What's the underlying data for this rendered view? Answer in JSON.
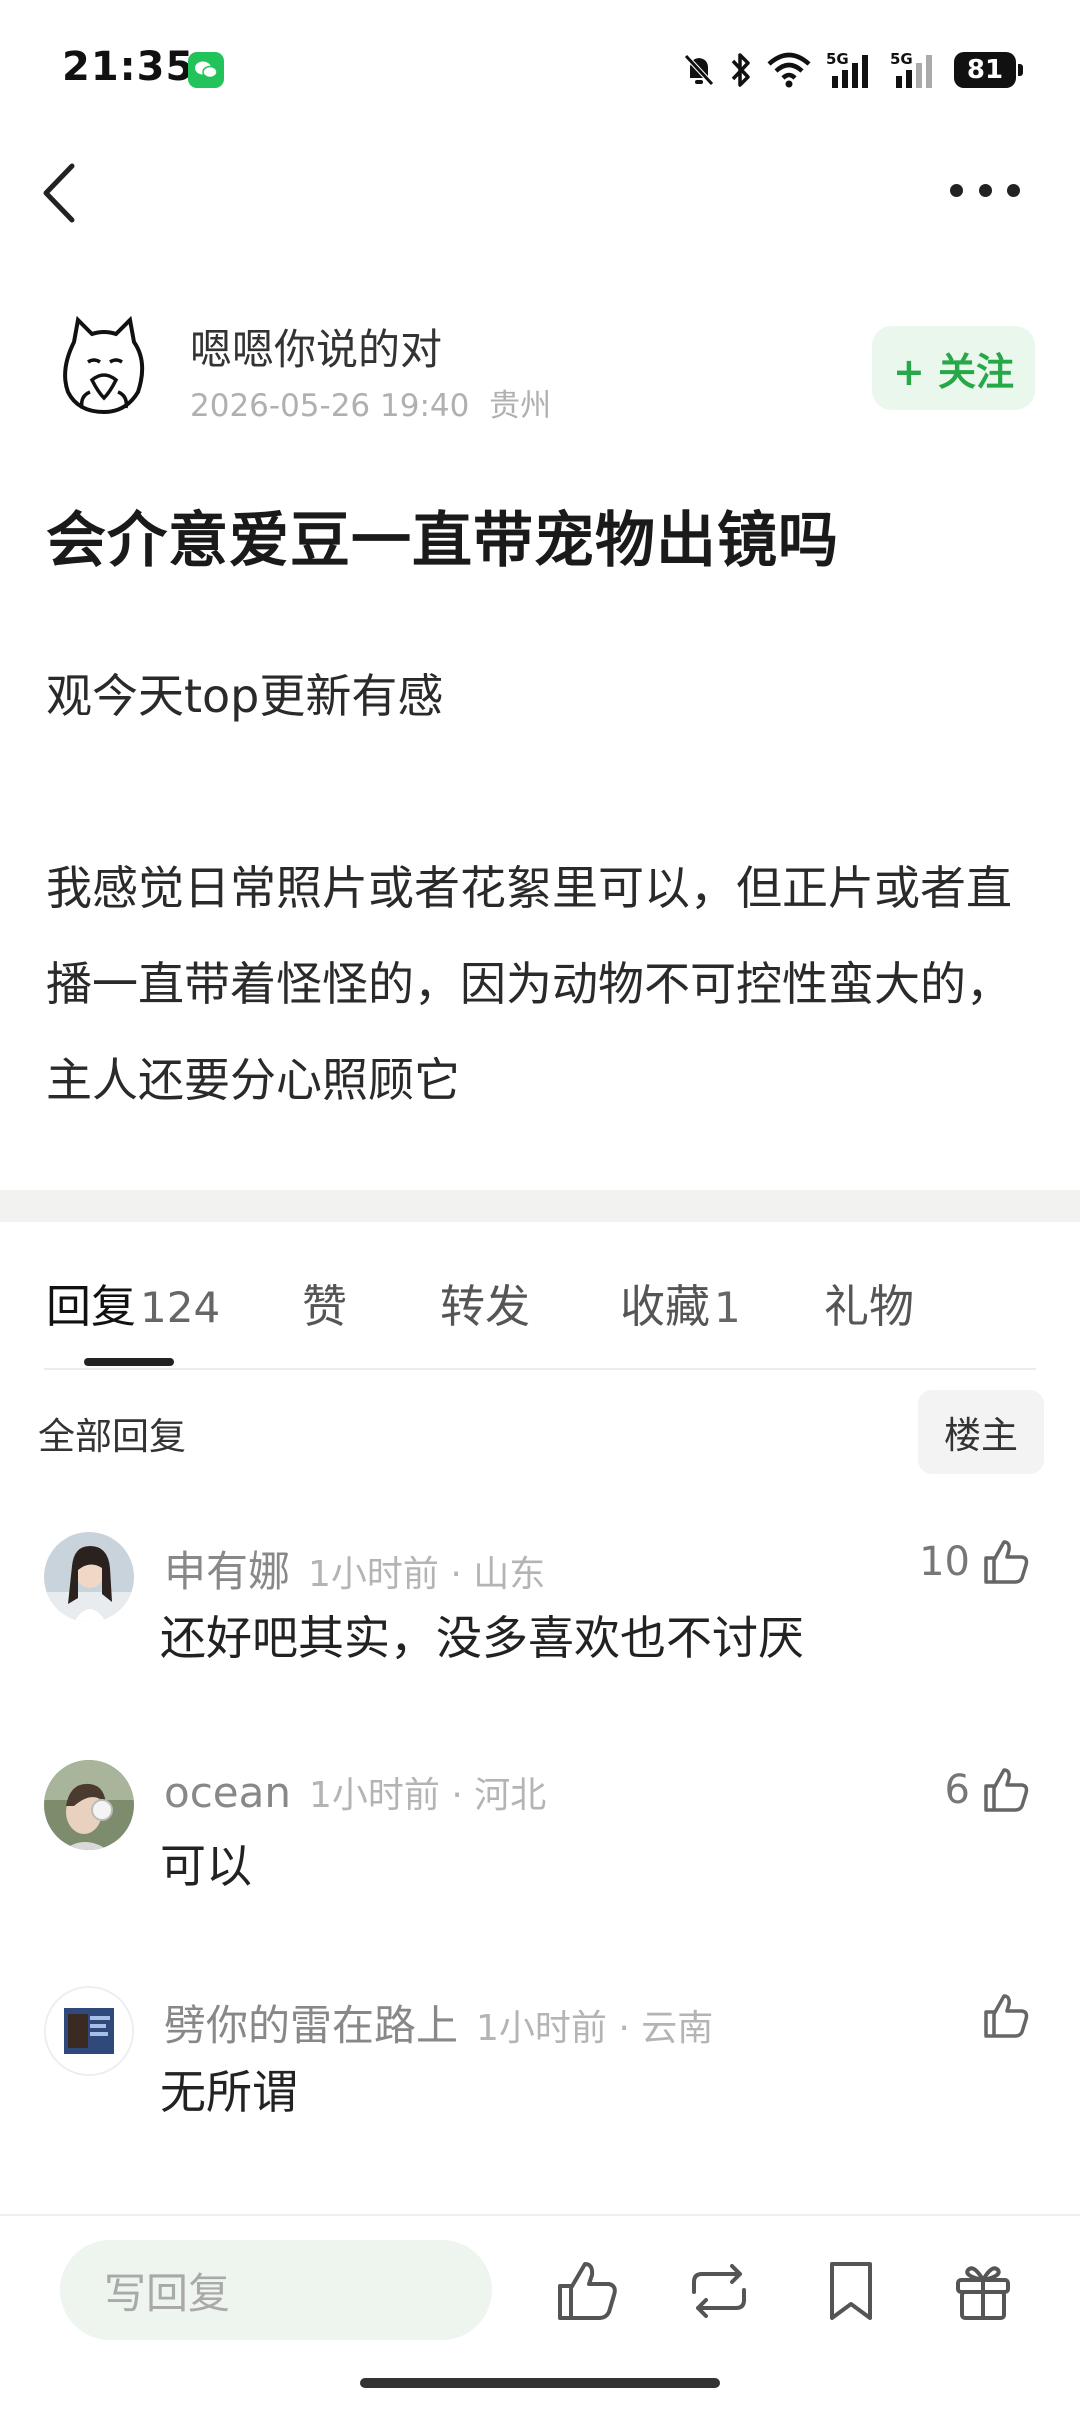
{
  "status_bar": {
    "time": "21:35",
    "battery": "81",
    "icons": [
      "wechat-icon",
      "mute-icon",
      "bluetooth-icon",
      "wifi-icon",
      "5g-signal-icon",
      "5g-signal-icon",
      "battery-icon"
    ],
    "network_label_1": "5G",
    "network_label_2": "5G"
  },
  "nav": {
    "back_icon": "chevron-left-icon",
    "more_icon": "more-dots-icon"
  },
  "author": {
    "name": "嗯嗯你说的对",
    "date": "2026-05-26 19:40",
    "location": "贵州",
    "follow_label": "+ 关注"
  },
  "post": {
    "title": "会介意爱豆一直带宠物出镜吗",
    "line1": "观今天top更新有感",
    "paragraph2": "我感觉日常照片或者花絮里可以，但正片或者直播一直带着怪怪的，因为动物不可控性蛮大的，主人还要分心照顾它"
  },
  "tabs": [
    {
      "label": "回复",
      "count": "124",
      "active": true
    },
    {
      "label": "赞",
      "count": ""
    },
    {
      "label": "转发",
      "count": ""
    },
    {
      "label": "收藏",
      "count": "1"
    },
    {
      "label": "礼物",
      "count": ""
    }
  ],
  "filter": {
    "all_label": "全部回复",
    "owner_label": "楼主"
  },
  "comments": [
    {
      "name": "申有娜",
      "time": "1小时前",
      "location": "山东",
      "text": "还好吧其实，没多喜欢也不讨厌",
      "likes": "10"
    },
    {
      "name": "ocean",
      "time": "1小时前",
      "location": "河北",
      "text": "可以",
      "likes": "6"
    },
    {
      "name": "劈你的雷在路上",
      "time": "1小时前",
      "location": "云南",
      "text": "无所谓",
      "likes": ""
    }
  ],
  "bottom_bar": {
    "reply_placeholder": "写回复",
    "icons": [
      "thumbs-up-icon",
      "repost-icon",
      "bookmark-icon",
      "gift-icon"
    ]
  },
  "colors": {
    "accent_green": "#27a848",
    "follow_bg": "#e9f7ec",
    "reply_bg": "#eef5ef"
  }
}
